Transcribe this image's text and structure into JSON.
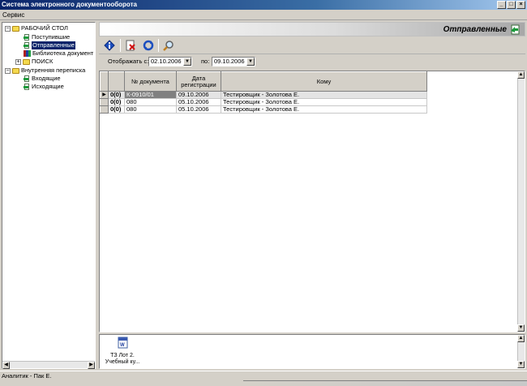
{
  "window": {
    "title": "Система электронного документооборота"
  },
  "menu": {
    "items": [
      "Сервис"
    ]
  },
  "tree": {
    "root": "РАБОЧИЙ СТОЛ",
    "desk_items": [
      {
        "label": "Поступившие",
        "icon": "incoming-doc-icon"
      },
      {
        "label": "Отправленные",
        "icon": "outgoing-doc-icon",
        "selected": true
      },
      {
        "label": "Библиотека документ",
        "icon": "library-icon"
      }
    ],
    "search": "ПОИСК",
    "internal": "Внутренняя переписка",
    "internal_items": [
      {
        "label": "Входящие",
        "icon": "incoming-doc-icon"
      },
      {
        "label": "Исходящие",
        "icon": "outgoing-doc-icon"
      }
    ]
  },
  "main": {
    "title": "Отправленные",
    "filter": {
      "from_label": "Отображать с:",
      "from_value": "02.10.2006",
      "to_label": "по:",
      "to_value": "09.10.2006"
    },
    "grid": {
      "columns": [
        "№ документа",
        "Дата регистрации",
        "Кому"
      ],
      "rows": [
        {
          "count": "0(0)",
          "doc_no": "К-0910/01",
          "date": "09.10.2006",
          "to": "Тестировщик - Золотова Е.",
          "active": true
        },
        {
          "count": "0(0)",
          "doc_no": "080",
          "date": "05.10.2006",
          "to": "Тестировщик - Золотова Е."
        },
        {
          "count": "0(0)",
          "doc_no": "080",
          "date": "05.10.2006",
          "to": "Тестировщик - Золотова Е."
        }
      ]
    },
    "attachments": [
      {
        "line1": "ТЗ Лот 2.",
        "line2": "Учебный ку..."
      }
    ]
  },
  "status": {
    "text": "Аналитик - Пак Е."
  },
  "colors": {
    "title_bar": "#0a246a",
    "selection": "#0a246a",
    "panel": "#d4d0c8"
  }
}
